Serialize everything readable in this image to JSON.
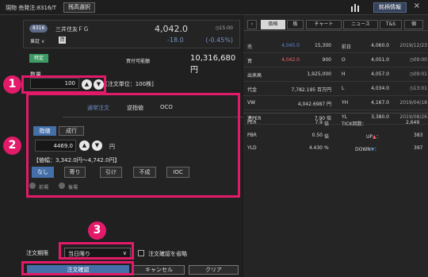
{
  "app": {
    "title": "現物 売発注:8316/T",
    "remaining_button": "残高選択",
    "stock_info_button": "銘柄情報",
    "chart_icon": "bar-chart-icon",
    "close_icon": "close-icon"
  },
  "stock": {
    "code": "8316",
    "name": "三井住友ＦＧ",
    "exchange": "東証",
    "exchange_chevron": "∨",
    "credit_badge": "貸",
    "price": "4,042.0",
    "time": "◷15:00",
    "change": "-18.0",
    "change_percent": "(-0.45%)"
  },
  "order": {
    "account_tag": "特定",
    "available_label": "買付可能額",
    "available_value": "10,316,680円",
    "quantity_label": "数量",
    "quantity_value": "100",
    "unit_note": "[注文単位：100株]",
    "tabs": [
      "通常注文",
      "逆指値",
      "OCO"
    ],
    "active_tab": "通常注文",
    "limit_label": "指値",
    "market_label": "成行",
    "price_value": "4469.0",
    "yen": "円",
    "price_range": "【値幅：3,342.0円～4,742.0円】",
    "conditions": [
      "なし",
      "寄り",
      "引け",
      "不成",
      "IOC"
    ],
    "selected_condition": "なし",
    "session_front": "前場",
    "session_back": "後場",
    "period_label": "注文期限",
    "period_value": "当日限り",
    "period_chevron": "∨",
    "skip_confirm_label": "注文確認を省略",
    "confirm_button": "注文確認",
    "cancel_button": "キャンセル",
    "clear_button": "クリア",
    "badges": [
      "1",
      "2",
      "3"
    ],
    "up_icon": "up-arrow-icon",
    "down_icon": "down-arrow-icon"
  },
  "right_panel": {
    "tabs": [
      "‹",
      "価格",
      "板",
      "チャート",
      "ニュース",
      "T&S",
      "個"
    ],
    "active_tab": "価格",
    "rows": [
      {
        "label": "売",
        "col1": "4,045.0",
        "col2": "15,300",
        "label2": "前日",
        "value2": "4,060.0",
        "date2": "2019/12/23"
      },
      {
        "label": "買",
        "col1": "4,042.0",
        "col2": "900",
        "label2": "O",
        "value2": "4,051.0",
        "date2": "◷09:00"
      },
      {
        "label": "出来高",
        "col1": "",
        "col2": "1,925,000",
        "label2": "H",
        "value2": "4,057.0",
        "date2": "◷09:01"
      },
      {
        "label": "代金",
        "col1": "",
        "col2": "7,782.195 百万円",
        "label2": "L",
        "value2": "4,034.0",
        "date2": "◷13:01"
      },
      {
        "label": "VW",
        "col1": "",
        "col2": "4,042.6987 円",
        "label2": "YH",
        "value2": "4,167.0",
        "date2": "2019/04/18"
      },
      {
        "label": "連PER",
        "col1": "",
        "col2": "7.90 倍",
        "label2": "YL",
        "value2": "3,380.0",
        "date2": "2019/08/26"
      }
    ],
    "stats": [
      {
        "label": "PER",
        "value": "7.9",
        "unit": "倍"
      },
      {
        "label": "PBR",
        "value": "0.50",
        "unit": "倍"
      },
      {
        "label": "YLD",
        "value": "4.430",
        "unit": "%"
      }
    ],
    "tick_label": "TICK回数：",
    "tick_value": "2,649",
    "up_label": "UP",
    "up_value": "383",
    "down_label": "DOWN",
    "down_value": "397",
    "colors": {
      "sell": "#5b87d6",
      "buy": "#ff6262",
      "accent": "#446fa9",
      "highlight": "#e31a69"
    }
  }
}
